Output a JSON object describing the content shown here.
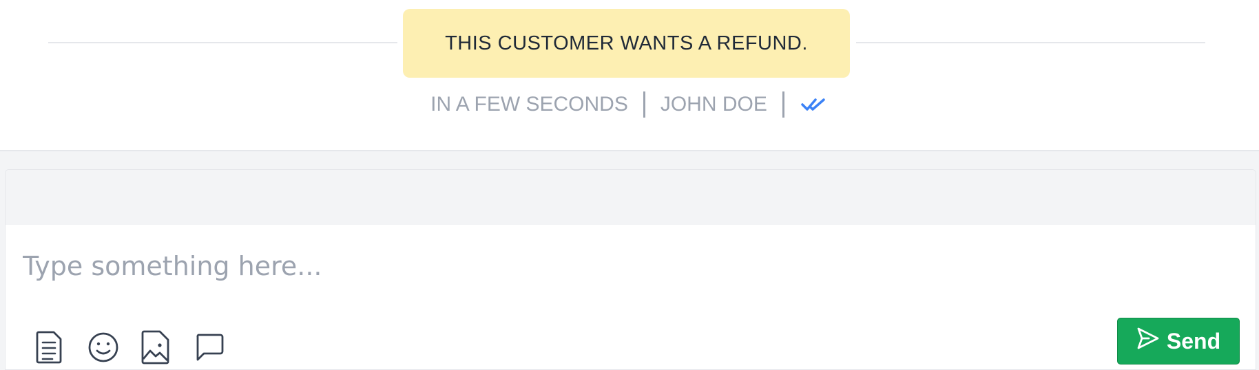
{
  "note": {
    "text": "THIS CUSTOMER WANTS A REFUND.",
    "time": "IN A FEW SECONDS",
    "author": "JOHN DOE",
    "status_icon": "double-check-icon"
  },
  "composer": {
    "placeholder": "Type something here...",
    "send_label": "Send",
    "send_icon": "send-icon",
    "tools": [
      "file-icon",
      "emoji-icon",
      "image-icon",
      "comment-icon"
    ]
  },
  "colors": {
    "note_bg": "#fdefb2",
    "send_bg": "#16a95a",
    "check_blue": "#3b82f6",
    "muted_text": "#9ca3af"
  }
}
